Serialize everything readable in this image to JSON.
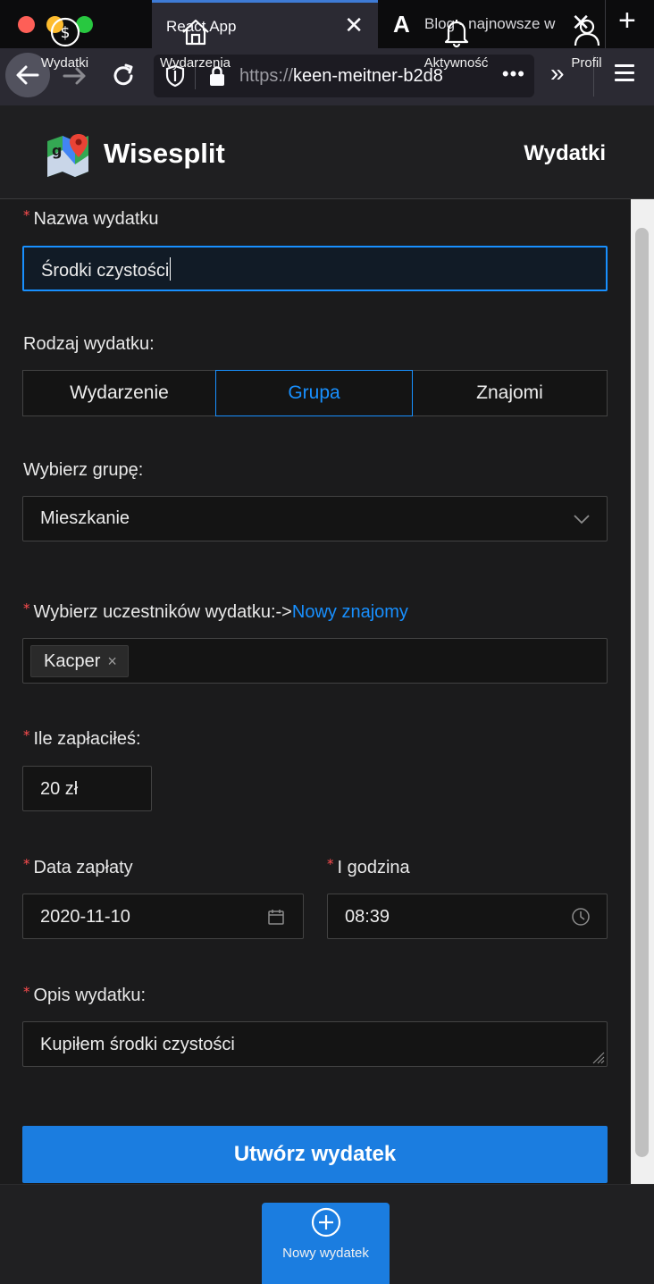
{
  "browser": {
    "tabs": [
      {
        "title": "React App",
        "active": true
      },
      {
        "title": "Blog - najnowsze w",
        "active": false,
        "favicon_letter": "A"
      }
    ],
    "new_tab_symbol": "+",
    "close_symbol": "✕",
    "url_scheme": "https://",
    "url_host": "keen-meitner-b2d8",
    "url_more": "•••",
    "overflow_symbol": "»"
  },
  "header": {
    "brand": "Wisesplit",
    "nav_link": "Wydatki"
  },
  "form": {
    "name_label": "Nazwa wydatku",
    "name_value": "Środki czystości",
    "type_label": "Rodzaj wydatku:",
    "type_options": [
      "Wydarzenie",
      "Grupa",
      "Znajomi"
    ],
    "type_selected": "Grupa",
    "group_label": "Wybierz grupę:",
    "group_value": "Mieszkanie",
    "participants_label": "Wybierz uczestników wydatku:->",
    "participants_link": "Nowy znajomy",
    "participants": [
      "Kacper"
    ],
    "tag_remove_symbol": "×",
    "paid_label": "Ile zapłaciłeś:",
    "paid_value": "20 zł",
    "date_label": "Data zapłaty",
    "date_value": "2020-11-10",
    "time_label": "I godzina",
    "time_value": "08:39",
    "desc_label": "Opis wydatku:",
    "desc_value": "Kupiłem środki czystości",
    "submit_label": "Utwórz wydatek",
    "required_mark": "*"
  },
  "bottom_nav": [
    {
      "label": "Wydatki",
      "icon": "dollar-circle-icon"
    },
    {
      "label": "Wydarzenia",
      "icon": "home-icon"
    },
    {
      "label": "Nowy wydatek",
      "icon": "plus-circle-icon",
      "active": true
    },
    {
      "label": "Aktywność",
      "icon": "bell-icon"
    },
    {
      "label": "Profil",
      "icon": "user-icon"
    }
  ],
  "colors": {
    "accent": "#1890ff",
    "button": "#1b7de0",
    "required": "#ff4d4f",
    "background": "#1b1b1c"
  }
}
